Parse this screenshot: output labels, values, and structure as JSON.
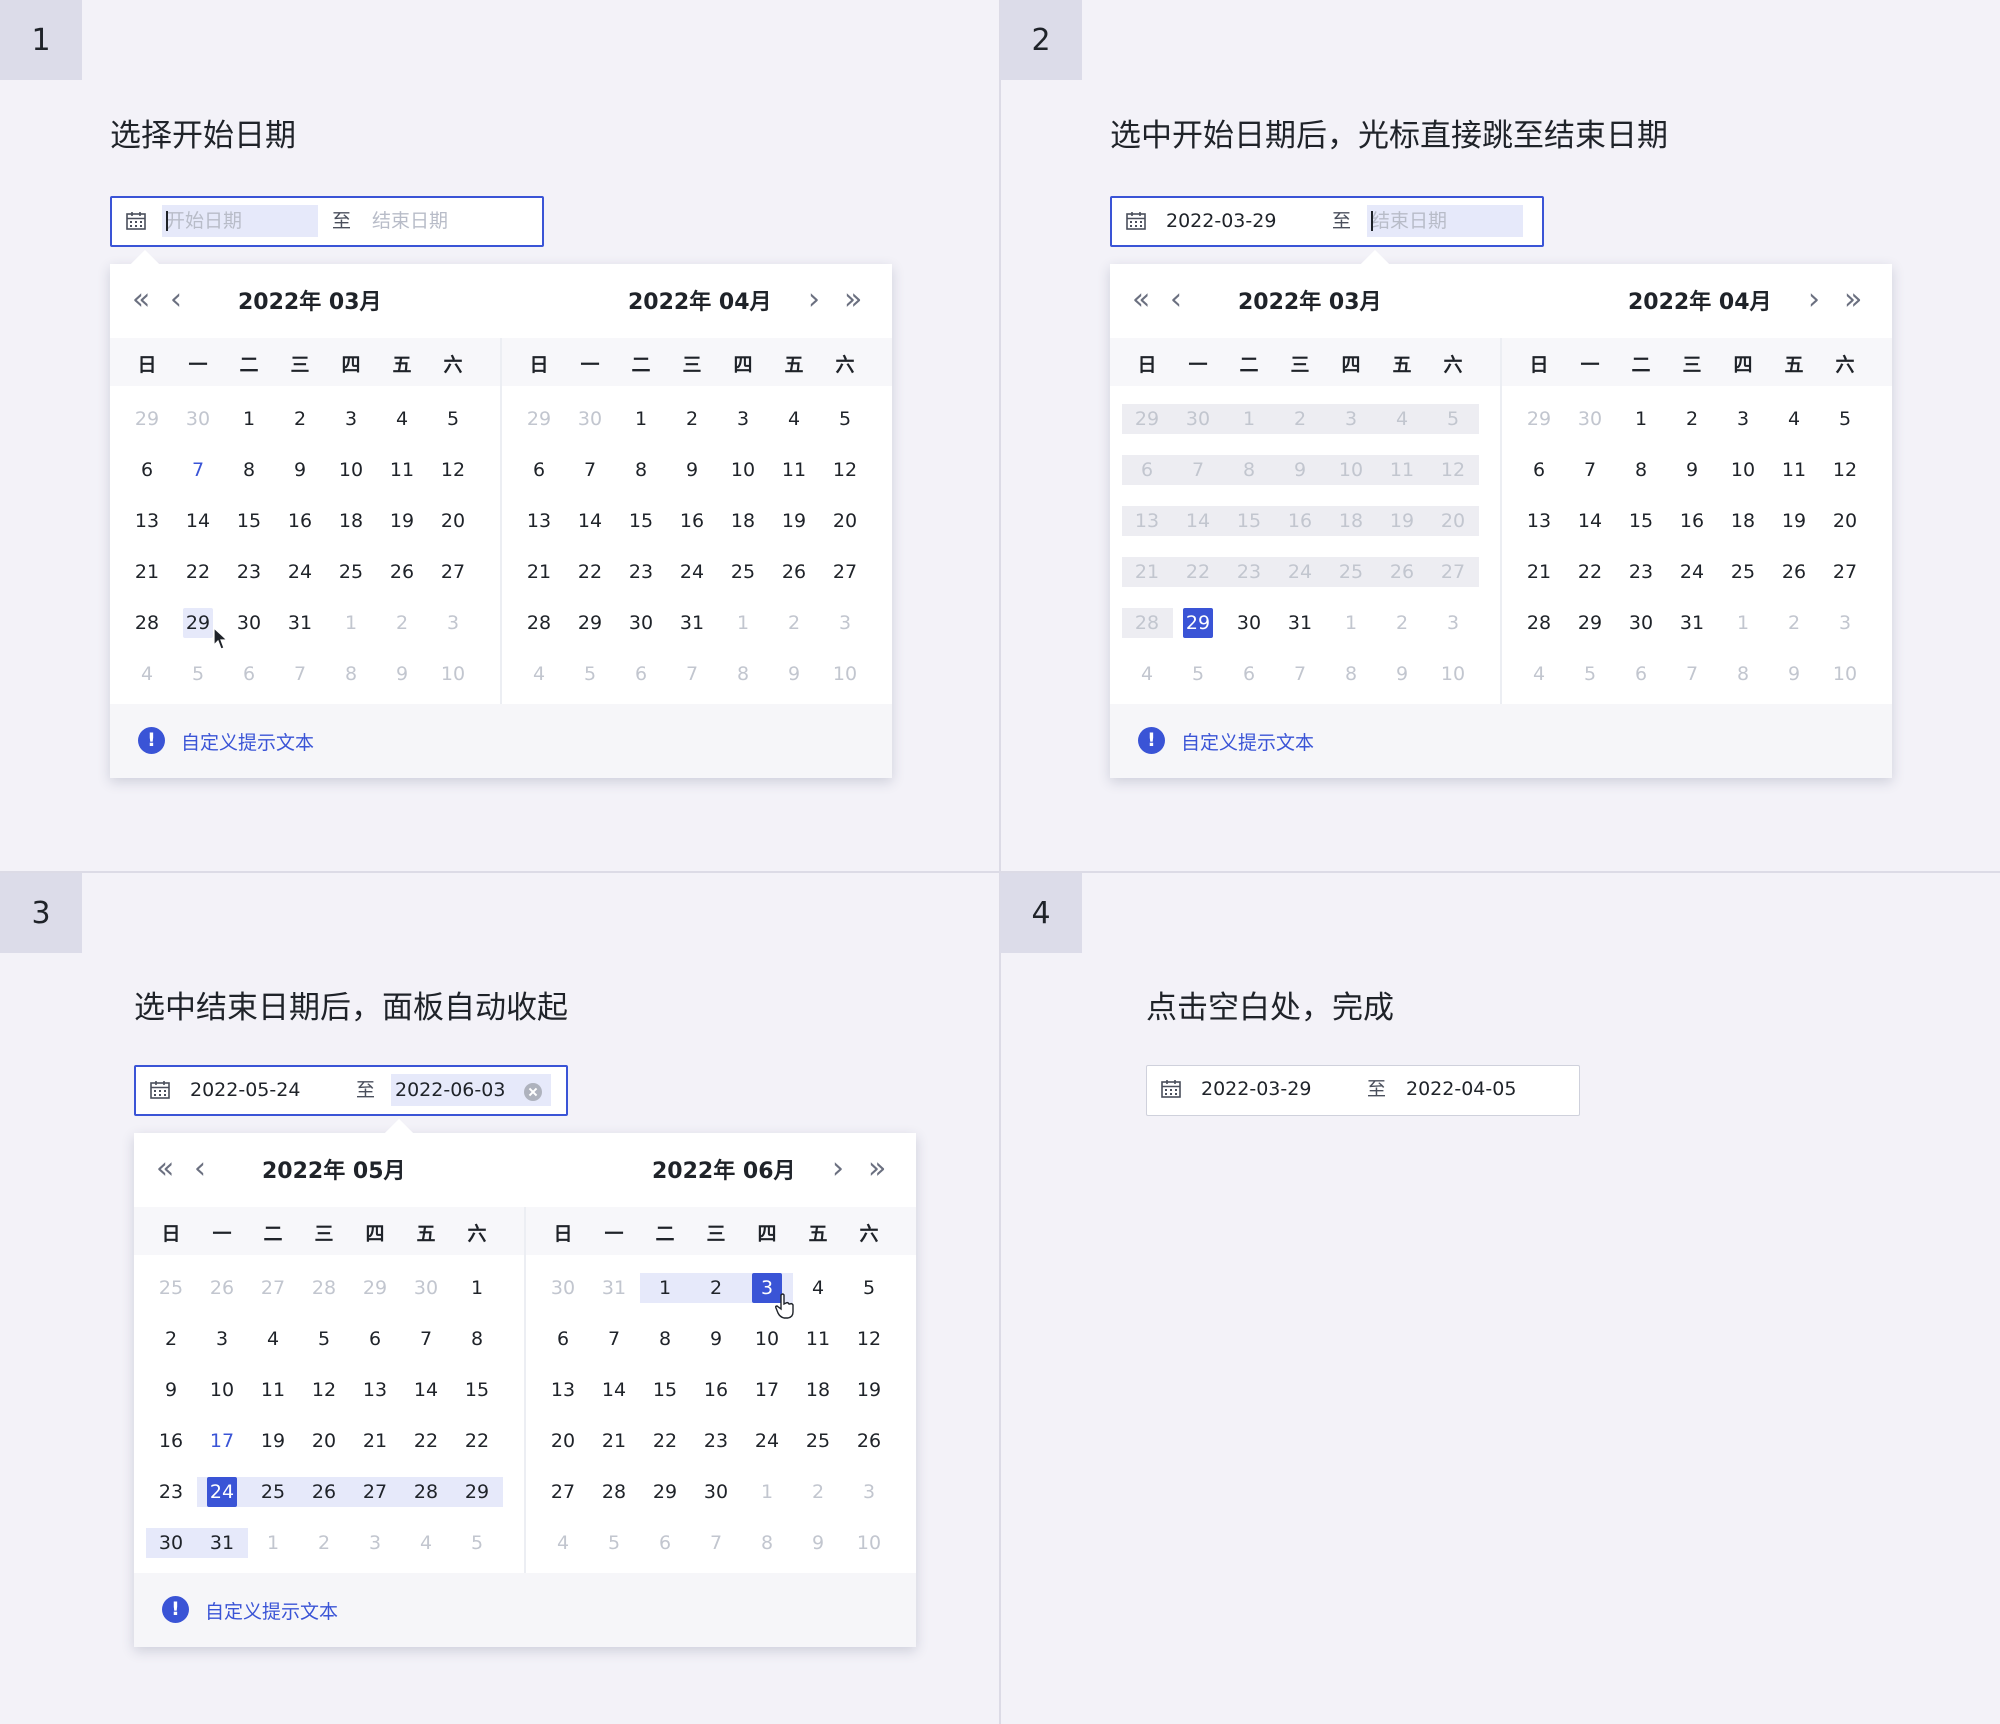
{
  "steps": [
    {
      "num": "1",
      "caption": "选择开始日期",
      "input": {
        "start": "开始日期",
        "end": "结束日期",
        "start_placeholder": true,
        "end_placeholder": true
      },
      "calendar": {
        "left": {
          "title": "2022年 03月",
          "weeks": [
            [
              "29",
              "30",
              "1",
              "2",
              "3",
              "4",
              "5"
            ],
            [
              "6",
              "7",
              "8",
              "9",
              "10",
              "11",
              "12"
            ],
            [
              "13",
              "14",
              "15",
              "16",
              "18",
              "19",
              "20"
            ],
            [
              "21",
              "22",
              "23",
              "24",
              "25",
              "26",
              "27"
            ],
            [
              "28",
              "29",
              "30",
              "31",
              "1",
              "2",
              "3"
            ],
            [
              "4",
              "5",
              "6",
              "7",
              "8",
              "9",
              "10"
            ]
          ]
        },
        "right": {
          "title": "2022年 04月",
          "weeks": [
            [
              "29",
              "30",
              "1",
              "2",
              "3",
              "4",
              "5"
            ],
            [
              "6",
              "7",
              "8",
              "9",
              "10",
              "11",
              "12"
            ],
            [
              "13",
              "14",
              "15",
              "16",
              "18",
              "19",
              "20"
            ],
            [
              "21",
              "22",
              "23",
              "24",
              "25",
              "26",
              "27"
            ],
            [
              "28",
              "29",
              "30",
              "31",
              "1",
              "2",
              "3"
            ],
            [
              "4",
              "5",
              "6",
              "7",
              "8",
              "9",
              "10"
            ]
          ]
        },
        "footer_tip": "自定义提示文本"
      }
    },
    {
      "num": "2",
      "caption": "选中开始日期后，光标直接跳至结束日期",
      "input": {
        "start": "2022-03-29",
        "end": "结束日期",
        "start_placeholder": false,
        "end_placeholder": true
      },
      "calendar": {
        "left": {
          "title": "2022年 03月",
          "weeks": [
            [
              "29",
              "30",
              "1",
              "2",
              "3",
              "4",
              "5"
            ],
            [
              "6",
              "7",
              "8",
              "9",
              "10",
              "11",
              "12"
            ],
            [
              "13",
              "14",
              "15",
              "16",
              "18",
              "19",
              "20"
            ],
            [
              "21",
              "22",
              "23",
              "24",
              "25",
              "26",
              "27"
            ],
            [
              "28",
              "29",
              "30",
              "31",
              "1",
              "2",
              "3"
            ],
            [
              "4",
              "5",
              "6",
              "7",
              "8",
              "9",
              "10"
            ]
          ]
        },
        "right": {
          "title": "2022年 04月",
          "weeks": [
            [
              "29",
              "30",
              "1",
              "2",
              "3",
              "4",
              "5"
            ],
            [
              "6",
              "7",
              "8",
              "9",
              "10",
              "11",
              "12"
            ],
            [
              "13",
              "14",
              "15",
              "16",
              "18",
              "19",
              "20"
            ],
            [
              "21",
              "22",
              "23",
              "24",
              "25",
              "26",
              "27"
            ],
            [
              "28",
              "29",
              "30",
              "31",
              "1",
              "2",
              "3"
            ],
            [
              "4",
              "5",
              "6",
              "7",
              "8",
              "9",
              "10"
            ]
          ]
        },
        "footer_tip": "自定义提示文本"
      }
    },
    {
      "num": "3",
      "caption": "选中结束日期后，面板自动收起",
      "input": {
        "start": "2022-05-24",
        "end": "2022-06-03",
        "start_placeholder": false,
        "end_placeholder": false
      },
      "calendar": {
        "left": {
          "title": "2022年 05月",
          "weeks": [
            [
              "25",
              "26",
              "27",
              "28",
              "29",
              "30",
              "1"
            ],
            [
              "2",
              "3",
              "4",
              "5",
              "6",
              "7",
              "8"
            ],
            [
              "9",
              "10",
              "11",
              "12",
              "13",
              "14",
              "15"
            ],
            [
              "16",
              "17",
              "19",
              "20",
              "21",
              "22",
              "22"
            ],
            [
              "23",
              "24",
              "25",
              "26",
              "27",
              "28",
              "29"
            ],
            [
              "30",
              "31",
              "1",
              "2",
              "3",
              "4",
              "5"
            ]
          ]
        },
        "right": {
          "title": "2022年 06月",
          "weeks": [
            [
              "30",
              "31",
              "1",
              "2",
              "3",
              "4",
              "5"
            ],
            [
              "6",
              "7",
              "8",
              "9",
              "10",
              "11",
              "12"
            ],
            [
              "13",
              "14",
              "15",
              "16",
              "17",
              "18",
              "19"
            ],
            [
              "20",
              "21",
              "22",
              "23",
              "24",
              "25",
              "26"
            ],
            [
              "27",
              "28",
              "29",
              "30",
              "1",
              "2",
              "3"
            ],
            [
              "4",
              "5",
              "6",
              "7",
              "8",
              "9",
              "10"
            ]
          ]
        },
        "footer_tip": "自定义提示文本"
      }
    },
    {
      "num": "4",
      "caption": "点击空白处，完成",
      "input": {
        "start": "2022-03-29",
        "end": "2022-04-05",
        "start_placeholder": false,
        "end_placeholder": false
      }
    }
  ],
  "weekdays": [
    "日",
    "一",
    "二",
    "三",
    "四",
    "五",
    "六"
  ],
  "separator": "至",
  "nav": {
    "prev_year": "«",
    "prev_month": "‹",
    "next_month": "›",
    "next_year": "»"
  },
  "icons": {
    "calendar": "calendar-icon",
    "clear": "clear-icon",
    "info": "info-icon",
    "cursor": "pointer-cursor-icon",
    "hand": "hand-cursor-icon"
  },
  "colors": {
    "accent": "#3a54d6",
    "range_bg": "#e6e9fa",
    "disabled_bg": "#ededf2",
    "page_bg": "#f3f2f8"
  }
}
